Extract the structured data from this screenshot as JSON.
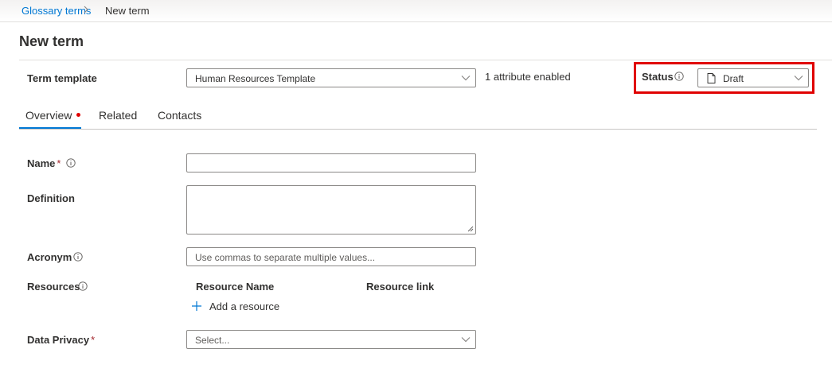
{
  "breadcrumb": {
    "parent": "Glossary terms",
    "current": "New term"
  },
  "page": {
    "title": "New term"
  },
  "term_template": {
    "label": "Term template",
    "selected": "Human Resources Template",
    "attributes_text": "1 attribute enabled"
  },
  "status": {
    "label": "Status",
    "selected": "Draft"
  },
  "tabs": [
    {
      "label": "Overview",
      "active": true,
      "has_indicator": true
    },
    {
      "label": "Related"
    },
    {
      "label": "Contacts"
    }
  ],
  "form": {
    "name": {
      "label": "Name",
      "required_mark": "*",
      "value": ""
    },
    "definition": {
      "label": "Definition",
      "value": ""
    },
    "acronym": {
      "label": "Acronym",
      "placeholder": "Use commas to separate multiple values..."
    },
    "resources": {
      "label": "Resources",
      "columns": [
        "Resource Name",
        "Resource link"
      ],
      "add_label": "Add a resource"
    },
    "data_privacy": {
      "label": "Data Privacy",
      "required_mark": "*",
      "placeholder": "Select..."
    }
  },
  "colors": {
    "accent": "#0078d4",
    "highlight": "#e00000",
    "required": "#a4262c"
  }
}
